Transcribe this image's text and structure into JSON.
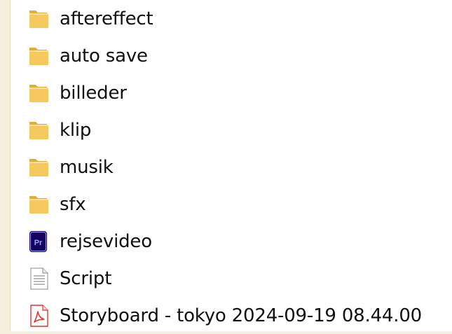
{
  "colors": {
    "background": "#f5efde",
    "panel": "#ffffff",
    "folder": "#f6c95e",
    "folder_dark": "#e2ac3c",
    "premiere": "#14005f",
    "premiere_text": "#9aa3ff",
    "pdf": "#e4322b"
  },
  "files": [
    {
      "name": "aftereffect",
      "icon": "folder-icon"
    },
    {
      "name": "auto save",
      "icon": "folder-icon"
    },
    {
      "name": "billeder",
      "icon": "folder-icon"
    },
    {
      "name": "klip",
      "icon": "folder-icon"
    },
    {
      "name": "musik",
      "icon": "folder-icon"
    },
    {
      "name": "sfx",
      "icon": "folder-icon"
    },
    {
      "name": "rejsevideo",
      "icon": "premiere-project-icon",
      "badge": "Pr"
    },
    {
      "name": "Script",
      "icon": "text-document-icon"
    },
    {
      "name": "Storyboard - tokyo 2024-09-19 08.44.00",
      "icon": "pdf-document-icon"
    }
  ]
}
